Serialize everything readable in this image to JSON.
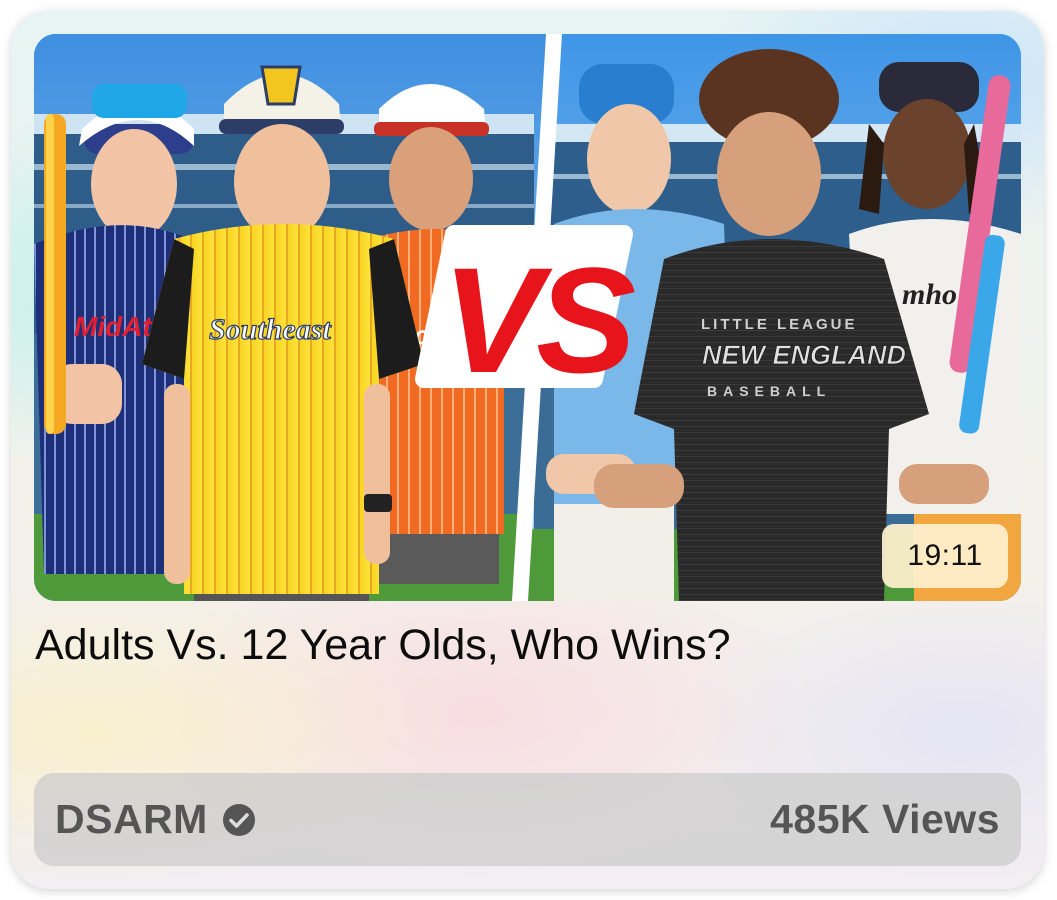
{
  "video": {
    "title": "Adults Vs. 12 Year Olds, Who Wins?",
    "duration": "19:11",
    "channel": "DSARM",
    "views": "485K Views",
    "thumbnail": {
      "vs_text": "VS",
      "left_jerseys": [
        "MidAtla",
        "Southeast",
        "outh"
      ],
      "right_shirt_line1": "LITTLE LEAGUE",
      "right_shirt_line2": "NEW ENGLAND",
      "right_shirt_line3": "BASEBALL"
    }
  },
  "icons": {
    "verified": "verified-check-icon"
  },
  "colors": {
    "vs_red": "#e8141b",
    "text_dark": "#0c0c0c",
    "meta_text": "#555555",
    "duration_bg": "#fff0cd"
  }
}
